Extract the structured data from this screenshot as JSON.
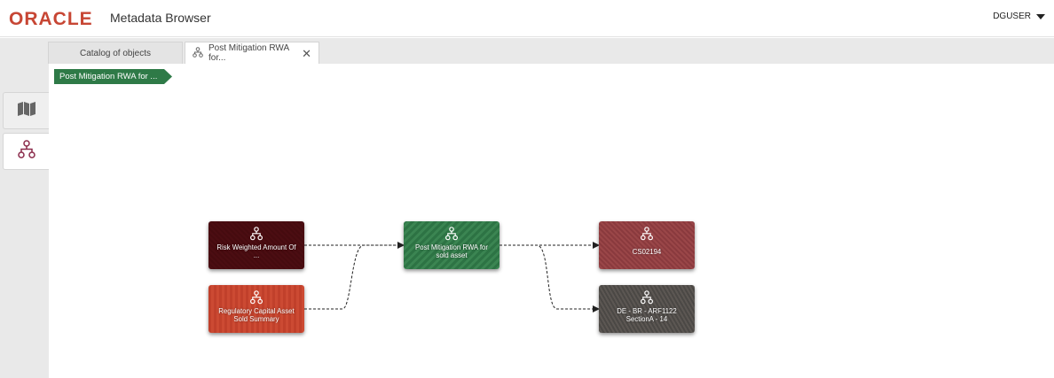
{
  "header": {
    "logo": "ORACLE",
    "app_title": "Metadata Browser",
    "user": "DGUSER"
  },
  "tabs": [
    {
      "label": "Catalog of objects",
      "icon": "none"
    },
    {
      "label": "Post Mitigation RWA for...",
      "icon": "lineage-icon",
      "close": "✕"
    }
  ],
  "sidebar": {
    "items": [
      {
        "name": "map",
        "icon": "map-icon"
      },
      {
        "name": "lineage",
        "icon": "lineage-icon",
        "selected": true
      }
    ]
  },
  "breadcrumb": {
    "label": "Post Mitigation RWA for ..."
  },
  "nodes": [
    {
      "label": "Risk Weighted Amount Of ...",
      "color": "#8a3a44"
    },
    {
      "label": "Regulatory Capital Asset Sold Summary",
      "color": "#c7452f"
    },
    {
      "label": "Post Mitigation RWA for sold asset",
      "color": "#2e7a47"
    },
    {
      "label": "CS02194",
      "color": "#923f43"
    },
    {
      "label": "DE - BR - ARF1122 SectionA - 14",
      "color": "#534f4b"
    }
  ],
  "colors": {
    "brand": "#c74634",
    "breadcrumb": "#2e7a47",
    "lineage_icon": "#8a2a4a"
  }
}
